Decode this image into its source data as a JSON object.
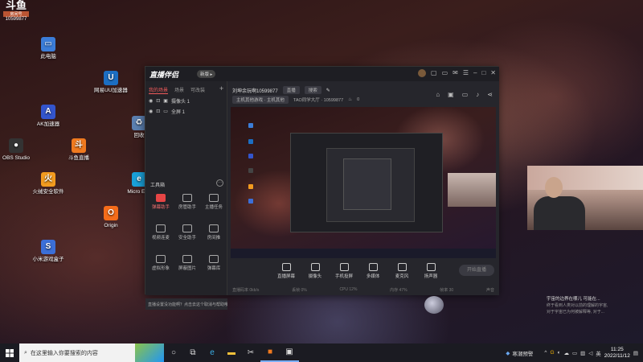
{
  "watermark": {
    "logo": "斗鱼",
    "sub": "房间号",
    "id": "10599877"
  },
  "desktop_icons": [
    {
      "name": "此电脑",
      "color": "#3b7dd8",
      "glyph": "▭"
    },
    {
      "name": "网易UU加速器",
      "color": "#1c6ec2",
      "glyph": "U"
    },
    {
      "name": "AK加速器",
      "color": "#3355cc",
      "glyph": "A"
    },
    {
      "name": "OBS Studio",
      "color": "#333333",
      "glyph": "●"
    },
    {
      "name": "斗鱼直播",
      "color": "#f07a1f",
      "glyph": "斗"
    },
    {
      "name": "火绒安全软件",
      "color": "#f29b1f",
      "glyph": "火"
    },
    {
      "name": "Origin",
      "color": "#f56c1a",
      "glyph": "O"
    },
    {
      "name": "小米游戏盒子",
      "color": "#3b6fd8",
      "glyph": "S"
    }
  ],
  "desktop_partial": [
    "回收",
    "Micro Edg"
  ],
  "app": {
    "title": "直播伴侣",
    "title_tag": "新版 ▸",
    "left_tabs": [
      "我的场景",
      "场景",
      "可改装"
    ],
    "scenes": [
      {
        "label": "摄像头 1"
      },
      {
        "label": "全屏 1"
      }
    ],
    "tools_title": "工具箱",
    "tools": [
      {
        "label": "弹幕助手",
        "red": true
      },
      {
        "label": "房管助手",
        "red": false
      },
      {
        "label": "主播任务",
        "red": false
      },
      {
        "label": "视频连麦",
        "red": false
      },
      {
        "label": "安全助手",
        "red": false
      },
      {
        "label": "房间推",
        "red": false
      },
      {
        "label": "虚拟形象",
        "red": false
      },
      {
        "label": "屏蔽图片",
        "red": false
      },
      {
        "label": "弹幕库",
        "red": false
      }
    ],
    "notice": "直播设置没功能啊？点击去这个取消与帮助哦",
    "room_title": "刘坤余玩啊10599877",
    "room_pill": "直播",
    "room_pill2": "搜索",
    "room_category": "主机其他游戏 · 主机其他",
    "room_extra": "TAO同学大厅 · 10599877",
    "room_hot": "0",
    "controls": [
      "直播屏幕",
      "摄像头",
      "手机投屏",
      "多媒体",
      "麦克风",
      "扬声器"
    ],
    "start_label": "开始直播",
    "status": [
      "直播码率 0kb/s",
      "丢帧 0%",
      "CPU 12%",
      "内存 47%",
      "帧率 30",
      "声音"
    ]
  },
  "toast": {
    "line1": "宇宙的边界在哪儿 可能在...",
    "line2": "终于看到人类对以前的理解的宇宙,",
    "line3": "对于宇宙已为何被解释等, 对于..."
  },
  "taskbar": {
    "search_placeholder": "在这里输入你要搜索的内容",
    "weather": "寒潮预警",
    "ime": "英",
    "time": "11:25",
    "date": "2022/11/12"
  },
  "colors": {
    "accent": "#f05a5a",
    "taskbar": "#1b1b22"
  }
}
